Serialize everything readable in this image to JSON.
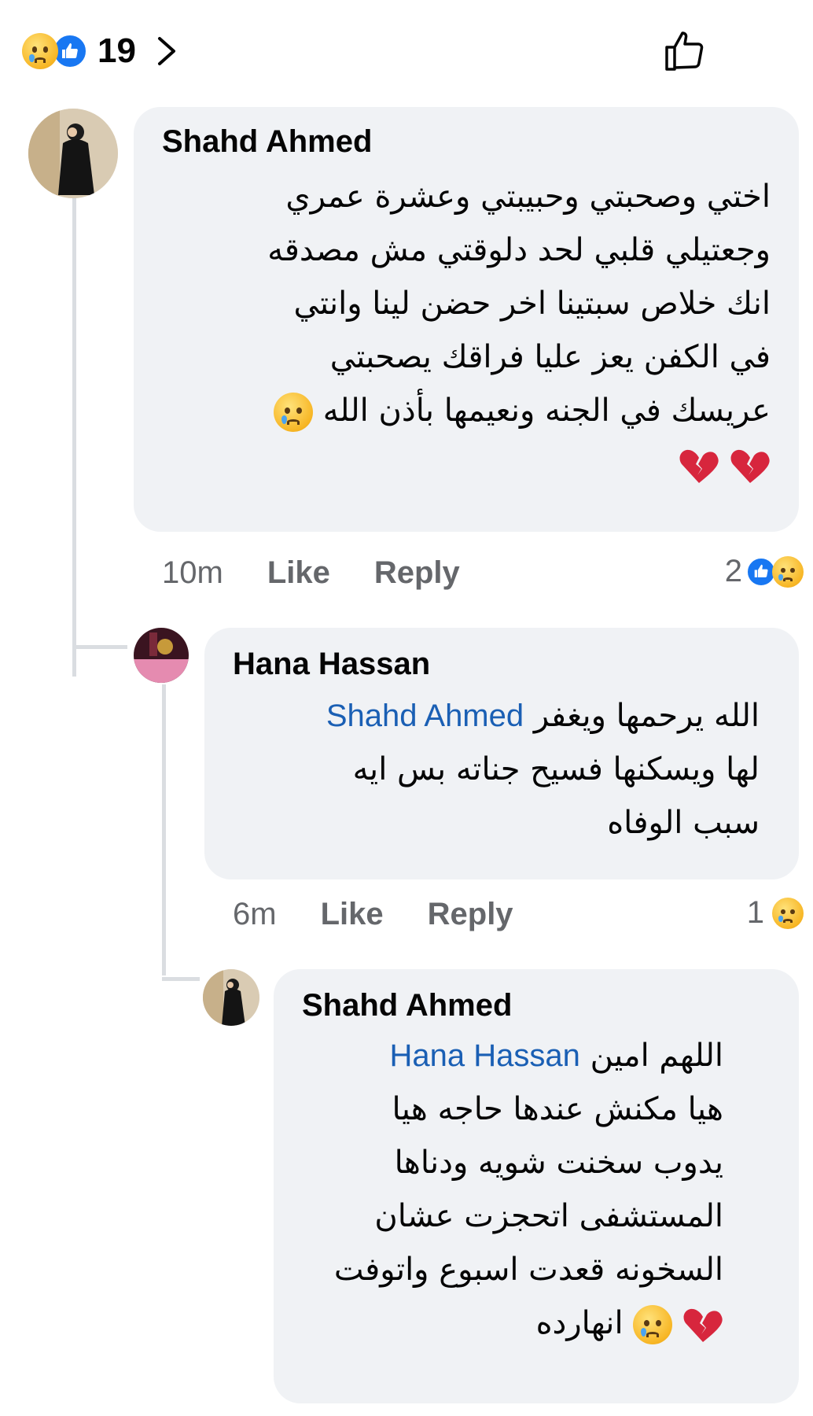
{
  "header": {
    "reaction_total": "19",
    "reaction_icons": [
      "sad-emoji",
      "like-thumb"
    ],
    "chevron_icon": "chevron-right",
    "thumb_icon": "thumb-up-outline"
  },
  "colors": {
    "bubble": "#f0f2f5",
    "mention": "#1a5fb4",
    "meta_text": "#65676b",
    "like_blue": "#1877f2",
    "heart_red": "#e0303a"
  },
  "comments": [
    {
      "author": "Shahd Ahmed",
      "lines": [
        "اختي وصحبتي وحبيبتي وعشرة عمري",
        "وجعتيلي قلبي لحد دلوقتي مش مصدقه",
        "انك خلاص سبتينا اخر حضن لينا وانتي",
        "في الكفن يعز عليا فراقك يصحبتي",
        "عريسك في الجنه ونعيمها بأذن الله"
      ],
      "time": "10m",
      "like_label": "Like",
      "reply_label": "Reply",
      "reaction_count": "2"
    },
    {
      "author": "Hana Hassan",
      "mention": "Shahd Ahmed",
      "first_line": "الله يرحمها ويغفر",
      "lines": [
        "لها ويسكنها فسيح جناته  بس ايه",
        "سبب الوفاه"
      ],
      "time": "6m",
      "like_label": "Like",
      "reply_label": "Reply",
      "reaction_count": "1"
    },
    {
      "author": "Shahd Ahmed",
      "mention": "Hana Hassan",
      "first_line": "اللهم امين",
      "lines": [
        "هيا مكنش عندها حاجه هيا",
        "يدوب سخنت شويه ودناها",
        "المستشفى اتحجزت عشان",
        "السخونه قعدت اسبوع واتوفت",
        "انهارده"
      ]
    }
  ]
}
